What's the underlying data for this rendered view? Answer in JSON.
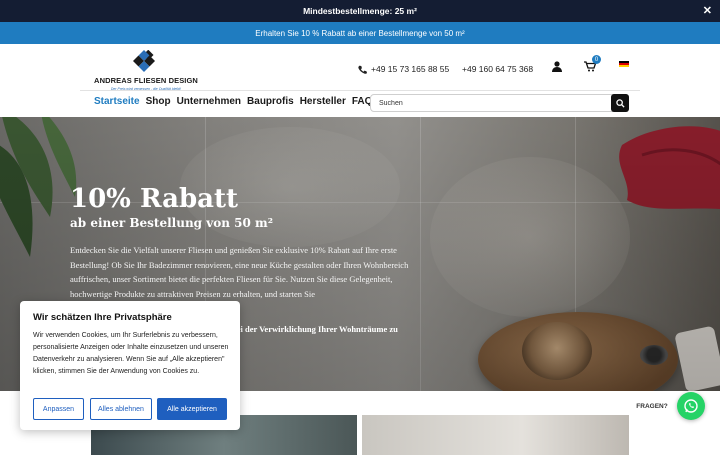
{
  "topbar": {
    "text": "Mindestbestellmenge: 25 m²",
    "close_icon": "close-icon"
  },
  "promobar": {
    "text": "Erhalten Sie 10 % Rabatt ab einer Bestellmenge von 50 m²"
  },
  "logo": {
    "brand": "ANDREAS FLIESEN DESIGN",
    "tagline": "Der Preis wird vergessen - die Qualität bleibt!"
  },
  "contact": {
    "phone1": "+49 15 73 165 88 55",
    "phone2": "+49 160 64 75 368"
  },
  "cart": {
    "count": "0"
  },
  "nav": {
    "items": [
      "Startseite",
      "Shop",
      "Unternehmen",
      "Bauprofis",
      "Hersteller",
      "FAQ"
    ],
    "active": "Startseite"
  },
  "search": {
    "placeholder": "Suchen"
  },
  "hero": {
    "title": "10% Rabatt",
    "subtitle": "ab einer Bestellung von 50 m²",
    "body": "Entdecken Sie die Vielfalt unserer Fliesen und genießen Sie exklusive 10% Rabatt auf Ihre erste Bestellung! Ob Sie Ihr Badezimmer renovieren, eine neue Küche gestalten oder Ihren Wohnbereich auffrischen, unser Sortiment bietet die perfekten Fliesen für Sie. Nutzen Sie diese Gelegenheit, hochwertige Produkte zu attraktiven Preisen zu erhalten, und starten Sie",
    "cta": "bei der Verwirklichung Ihrer Wohnträume zu"
  },
  "cookie": {
    "title": "Wir schätzen Ihre Privatsphäre",
    "text": "Wir verwenden Cookies, um Ihr Surferlebnis zu verbessern, personalisierte Anzeigen oder Inhalte einzusetzen und unseren Datenverkehr zu analysieren. Wenn Sie auf „Alle akzeptieren\" klicken, stimmen Sie der Anwendung von Cookies zu.",
    "btn_customize": "Anpassen",
    "btn_reject": "Alles ablehnen",
    "btn_accept": "Alle akzeptieren"
  },
  "chat": {
    "label": "FRAGEN?"
  },
  "colors": {
    "topbar": "#141d33",
    "promobar": "#1f7cc0",
    "accent": "#1f7cc0",
    "cookie_button": "#1f5fbf",
    "whatsapp": "#25d366"
  }
}
